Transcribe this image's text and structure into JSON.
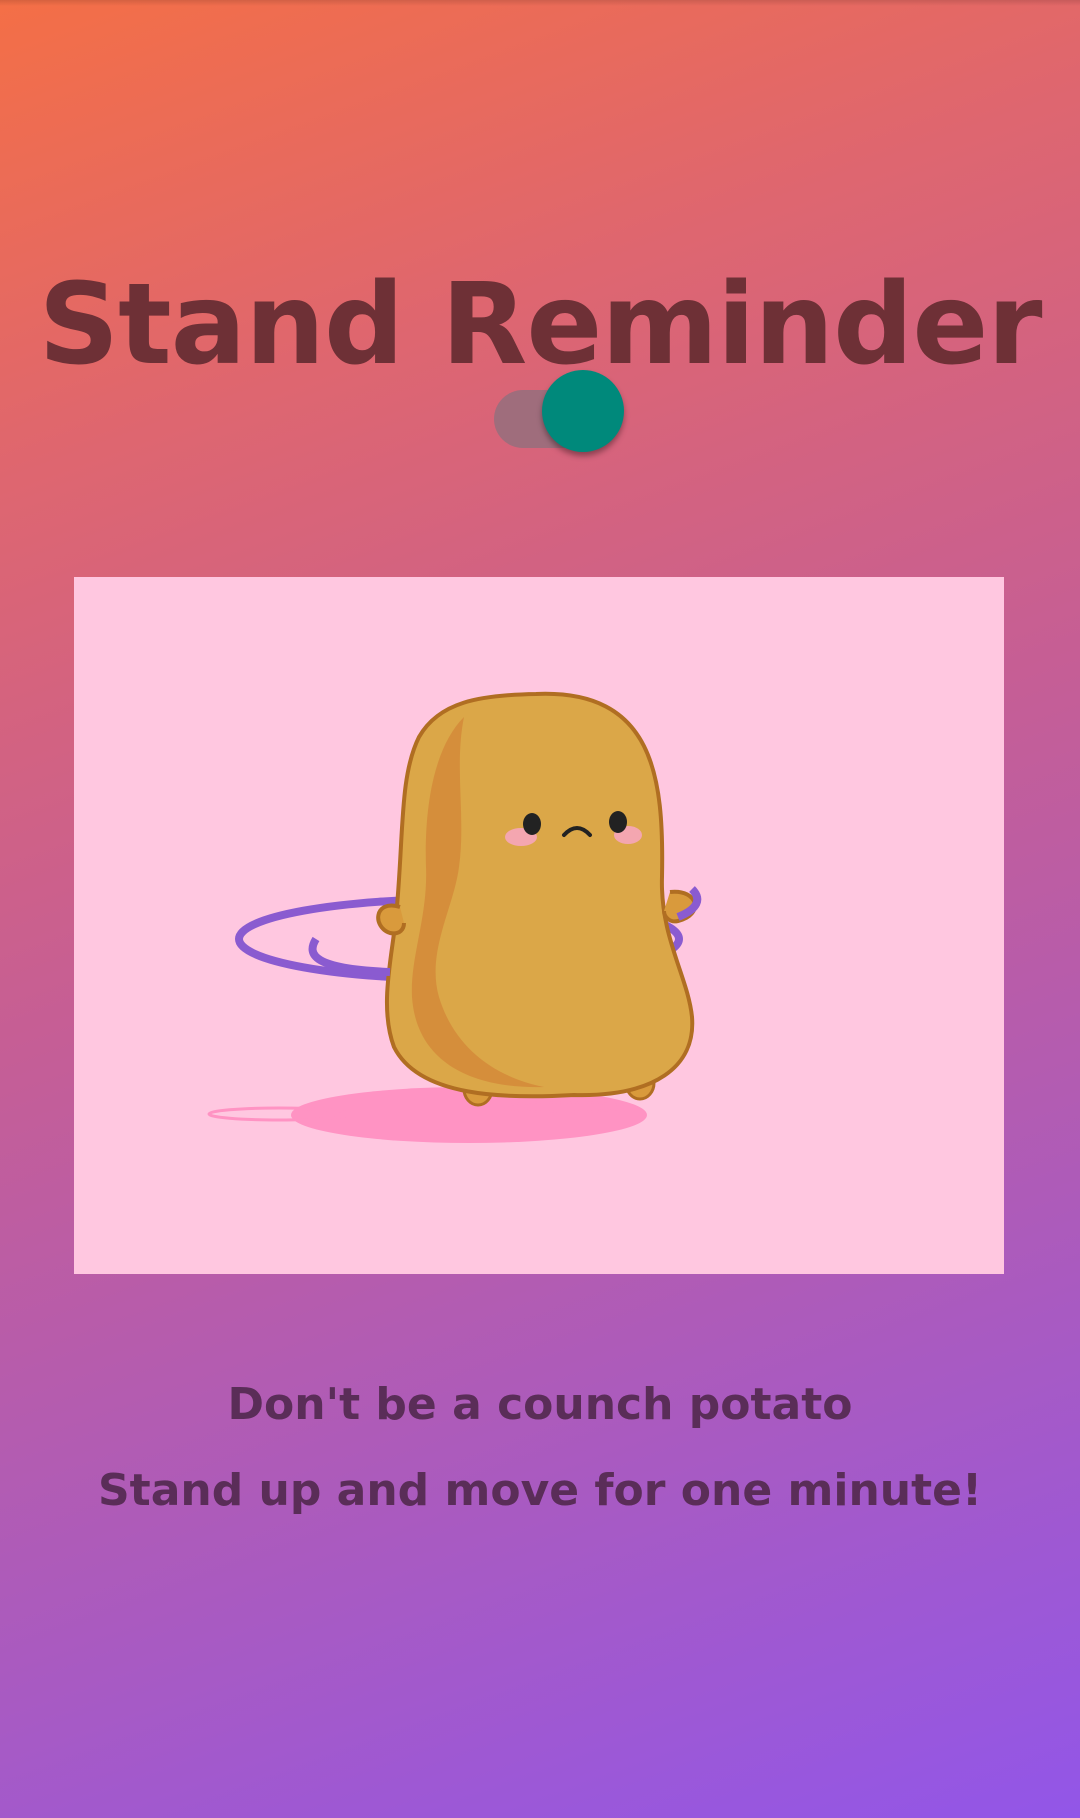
{
  "app": {
    "title": "Stand Reminder"
  },
  "reminder_toggle": {
    "state": "on",
    "thumb_color": "#00897b",
    "track_color": "#9c6e7c"
  },
  "illustration": {
    "icon": "potato-hula-hoop-icon",
    "background_color": "#ffc7e0"
  },
  "messages": {
    "line1": "Don't be a counch potato",
    "line2": "Stand up and move for one minute!"
  },
  "colors": {
    "title": "#6e3036",
    "message": "#5a2d58",
    "gradient_start": "#f46f46",
    "gradient_end": "#9256e8"
  }
}
